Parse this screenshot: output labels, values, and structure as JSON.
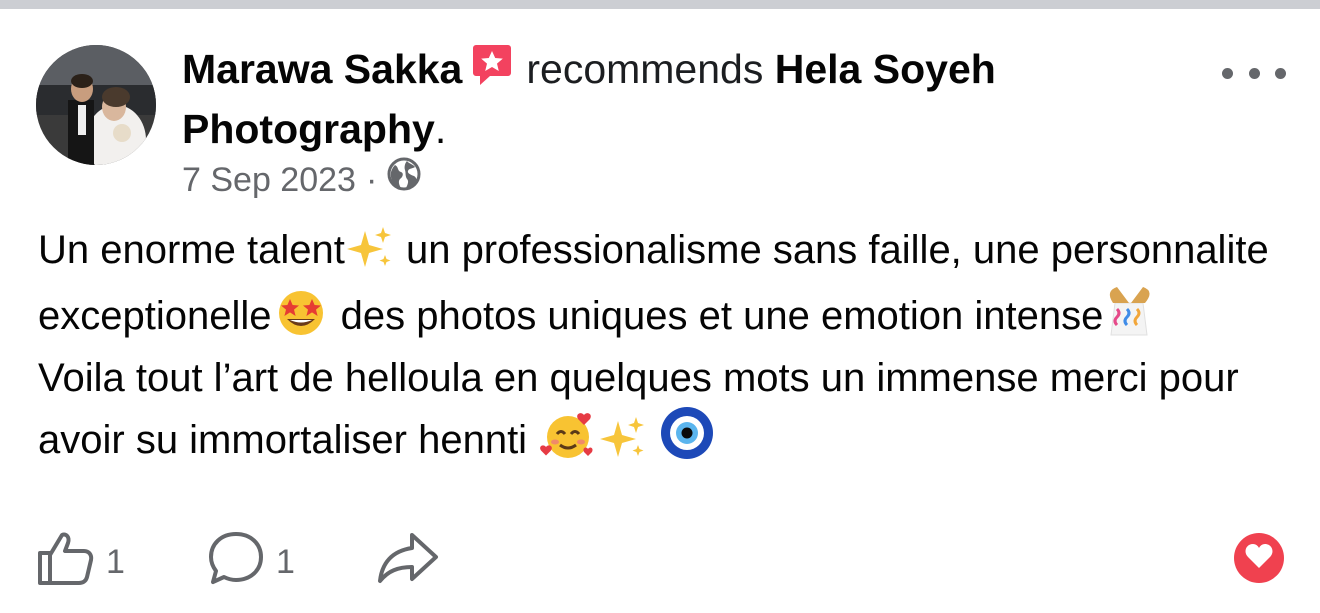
{
  "post": {
    "author": "Marawa Sakka",
    "action": "recommends",
    "target": "Hela Soyeh Photography",
    "target_suffix": ".",
    "date": "7 Sep 2023",
    "separator": "·",
    "privacy_icon": "globe-icon",
    "recommend_icon": "recommend-badge-icon",
    "menu_icon": "more-options-icon",
    "body": {
      "line1a": "Un enorme talent",
      "line1b": " un professionalisme sans faille, une personnalite exceptionelle",
      "line1c": " des photos uniques et une emotion intense",
      "line2a": "Voila tout l’art de helloula en quelques mots un immense merci pour avoir su immortaliser hennti "
    },
    "emojis": [
      "sparkles",
      "star-struck",
      "confetti",
      "smiling-face-with-hearts",
      "sparkles",
      "nazar-amulet"
    ]
  },
  "actions": {
    "like_count": "1",
    "comment_count": "1",
    "like_icon": "thumbs-up-icon",
    "comment_icon": "comment-icon",
    "share_icon": "share-icon",
    "reaction_icon": "heart-icon"
  },
  "colors": {
    "recommend_badge": "#f3425f",
    "love_reaction": "#f0414f",
    "secondary_text": "#65676b"
  }
}
